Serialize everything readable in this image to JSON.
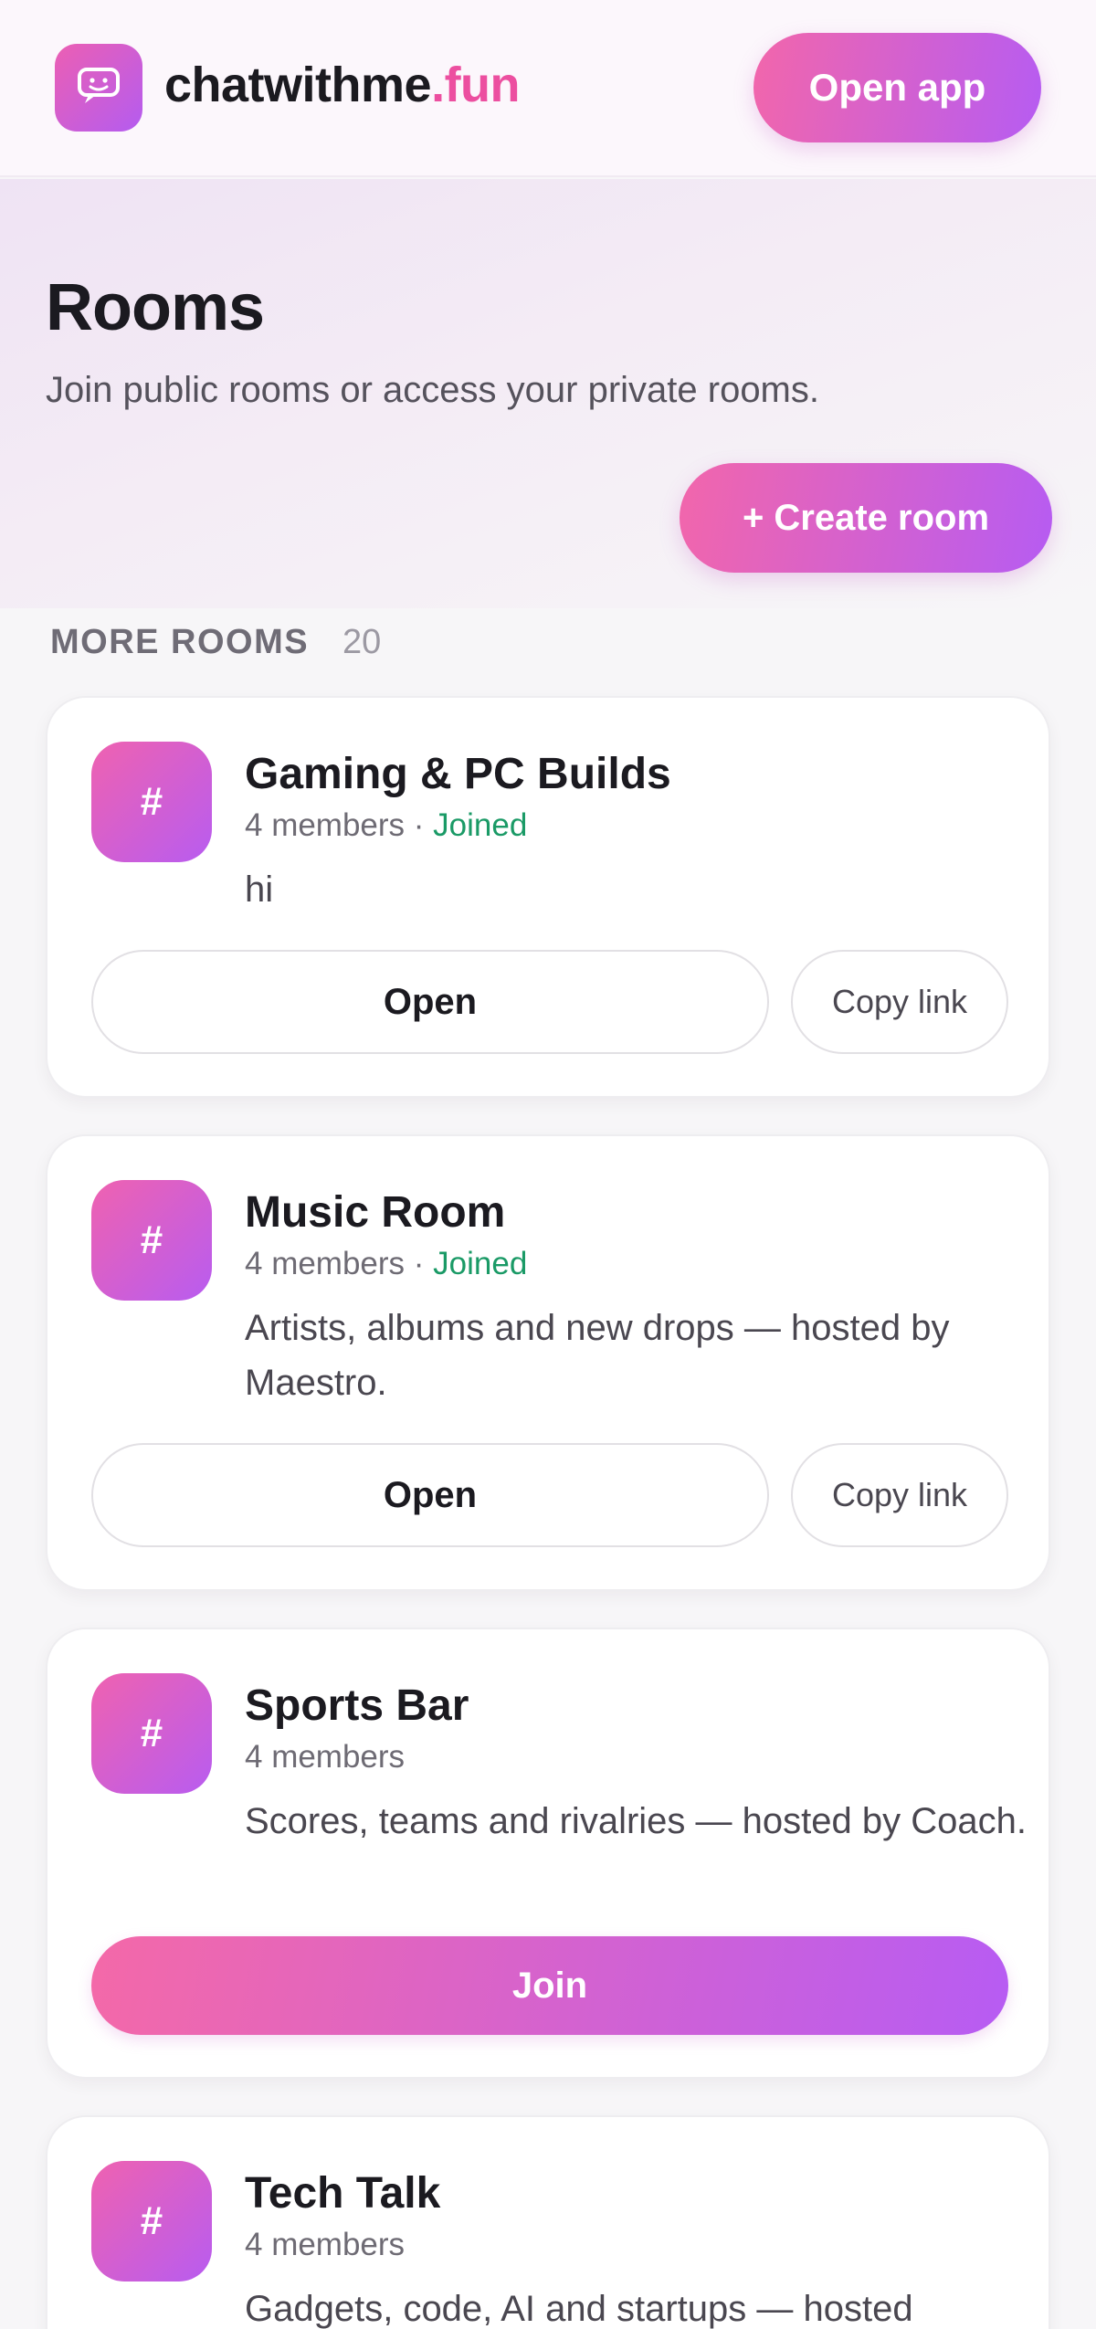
{
  "header": {
    "brand_main": "chatwithme",
    "brand_accent": ".fun",
    "open_app_label": "Open app",
    "logo_icon": "chat-bubble-smile-icon"
  },
  "page": {
    "title": "Rooms",
    "subtitle": "Join public rooms or access your private rooms.",
    "create_label": "+ Create room"
  },
  "section": {
    "label": "MORE ROOMS",
    "count": "20"
  },
  "rooms": [
    {
      "icon": "#",
      "name": "Gaming & PC Builds",
      "members": "4 members",
      "separator": " · ",
      "status": "Joined",
      "description": "hi",
      "primary_label": "Open",
      "secondary_label": "Copy link"
    },
    {
      "icon": "#",
      "name": "Music Room",
      "members": "4 members",
      "separator": " · ",
      "status": "Joined",
      "description": "Artists, albums and new drops — hosted by Maestro.",
      "primary_label": "Open",
      "secondary_label": "Copy link"
    },
    {
      "icon": "#",
      "name": "Sports Bar",
      "members": "4 members",
      "description": "Scores, teams and rivalries — hosted by Coach.",
      "primary_label": "Join"
    },
    {
      "icon": "#",
      "name": "Tech Talk",
      "members": "4 members",
      "description": "Gadgets, code, AI and startups — hosted"
    }
  ],
  "colors": {
    "accent_pink": "#ec4fa0",
    "accent_purple": "#b65cf2",
    "joined_green": "#1a9a66"
  }
}
